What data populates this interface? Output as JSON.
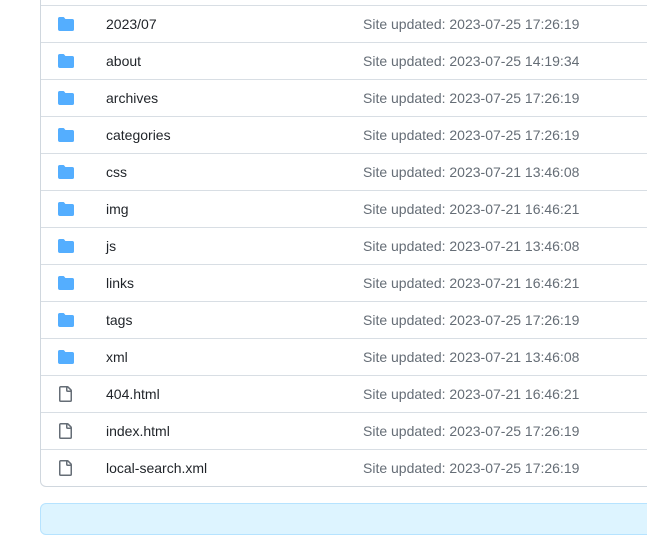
{
  "colors": {
    "folder": "#54aeff",
    "file": "#656d76",
    "banner": "#ddf4ff"
  },
  "files": [
    {
      "name": "2023/07",
      "icon": "folder-icon",
      "message": "Site updated: 2023-07-25 17:26:19"
    },
    {
      "name": "about",
      "icon": "folder-icon",
      "message": "Site updated: 2023-07-25 14:19:34"
    },
    {
      "name": "archives",
      "icon": "folder-icon",
      "message": "Site updated: 2023-07-25 17:26:19"
    },
    {
      "name": "categories",
      "icon": "folder-icon",
      "message": "Site updated: 2023-07-25 17:26:19"
    },
    {
      "name": "css",
      "icon": "folder-icon",
      "message": "Site updated: 2023-07-21 13:46:08"
    },
    {
      "name": "img",
      "icon": "folder-icon",
      "message": "Site updated: 2023-07-21 16:46:21"
    },
    {
      "name": "js",
      "icon": "folder-icon",
      "message": "Site updated: 2023-07-21 13:46:08"
    },
    {
      "name": "links",
      "icon": "folder-icon",
      "message": "Site updated: 2023-07-21 16:46:21"
    },
    {
      "name": "tags",
      "icon": "folder-icon",
      "message": "Site updated: 2023-07-25 17:26:19"
    },
    {
      "name": "xml",
      "icon": "folder-icon",
      "message": "Site updated: 2023-07-21 13:46:08"
    },
    {
      "name": "404.html",
      "icon": "file-icon",
      "message": "Site updated: 2023-07-21 16:46:21"
    },
    {
      "name": "index.html",
      "icon": "file-icon",
      "message": "Site updated: 2023-07-25 17:26:19"
    },
    {
      "name": "local-search.xml",
      "icon": "file-icon",
      "message": "Site updated: 2023-07-25 17:26:19"
    }
  ]
}
